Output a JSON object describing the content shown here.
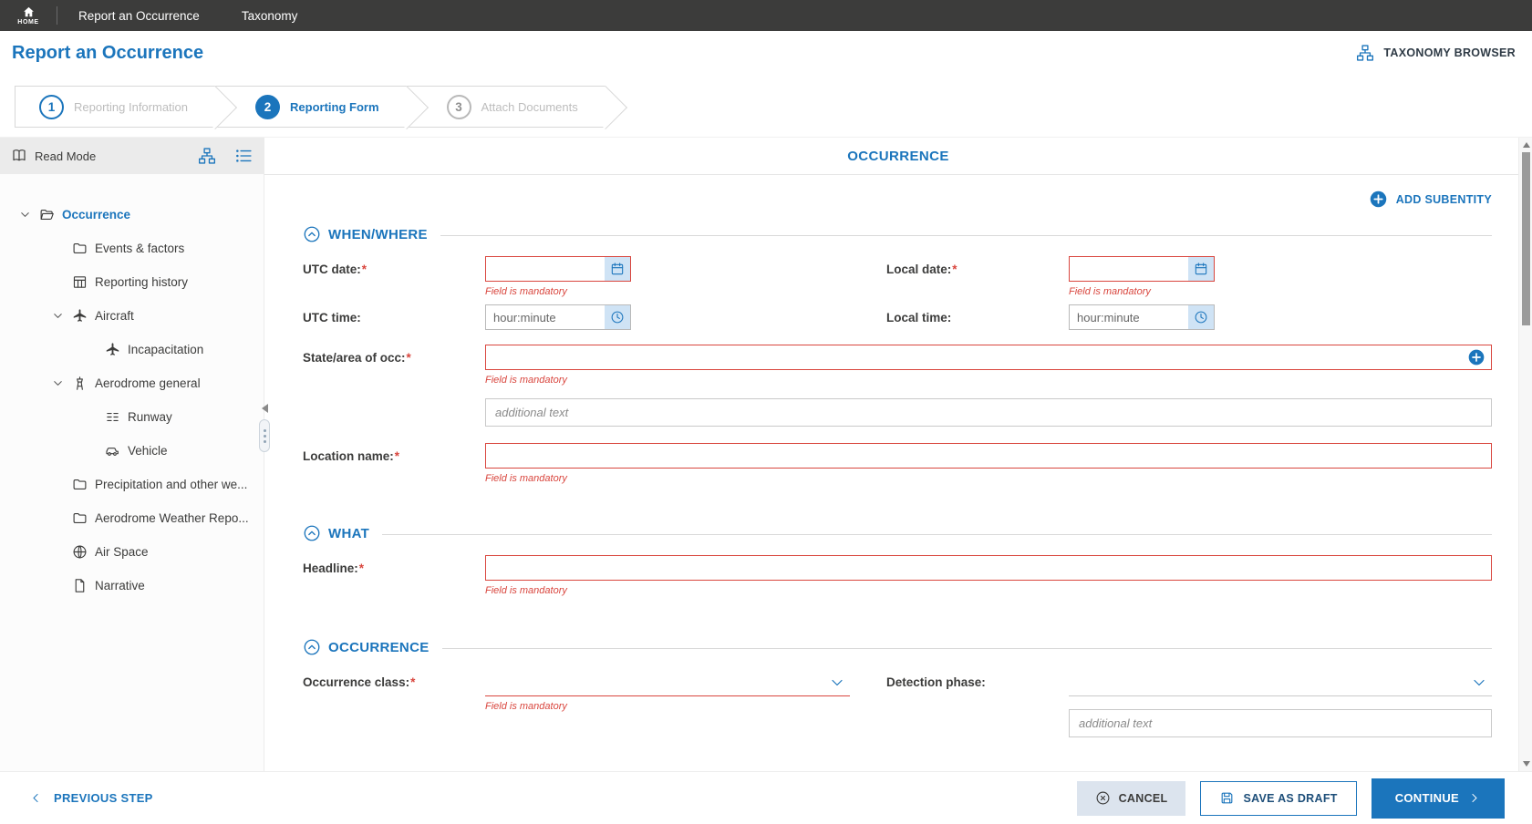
{
  "colors": {
    "accent_blue": "#1b75bc",
    "error_red": "#d9463e",
    "topnav_bg": "#3c3c3b"
  },
  "misc": {
    "required_mark": "*"
  },
  "topnav": {
    "home_label": "HOME",
    "items": [
      {
        "label": "Report an Occurrence"
      },
      {
        "label": "Taxonomy"
      }
    ]
  },
  "header": {
    "title": "Report an Occurrence",
    "taxonomy_browser_label": "TAXONOMY BROWSER"
  },
  "stepper": {
    "steps": [
      {
        "number": "1",
        "label": "Reporting Information",
        "state": "done"
      },
      {
        "number": "2",
        "label": "Reporting Form",
        "state": "active"
      },
      {
        "number": "3",
        "label": "Attach Documents",
        "state": "upcoming"
      }
    ]
  },
  "sidebar": {
    "read_mode_label": "Read Mode",
    "tree": [
      {
        "label": "Occurrence",
        "icon": "folder-open-icon",
        "level": 0,
        "expanded": true,
        "selected": true
      },
      {
        "label": "Events & factors",
        "icon": "folder-icon",
        "level": 1
      },
      {
        "label": "Reporting history",
        "icon": "table-icon",
        "level": 1
      },
      {
        "label": "Aircraft",
        "icon": "aircraft-icon",
        "level": 1,
        "expanded": true
      },
      {
        "label": "Incapacitation",
        "icon": "aircraft-icon",
        "level": 2
      },
      {
        "label": "Aerodrome general",
        "icon": "tower-icon",
        "level": 1,
        "expanded": true
      },
      {
        "label": "Runway",
        "icon": "runway-icon",
        "level": 2
      },
      {
        "label": "Vehicle",
        "icon": "vehicle-icon",
        "level": 2
      },
      {
        "label": "Precipitation and other we...",
        "icon": "folder-icon",
        "level": 1
      },
      {
        "label": "Aerodrome Weather Repo...",
        "icon": "folder-icon",
        "level": 1
      },
      {
        "label": "Air Space",
        "icon": "globe-icon",
        "level": 1
      },
      {
        "label": "Narrative",
        "icon": "document-icon",
        "level": 1
      }
    ]
  },
  "content": {
    "entity_title": "OCCURRENCE",
    "add_subentity_label": "ADD SUBENTITY",
    "sections": {
      "when_where": {
        "title": "WHEN/WHERE"
      },
      "what": {
        "title": "WHAT"
      },
      "occurrence": {
        "title": "OCCURRENCE"
      }
    },
    "fields": {
      "utc_date": {
        "label": "UTC date:",
        "error": "Field is mandatory"
      },
      "local_date": {
        "label": "Local date:",
        "error": "Field is mandatory"
      },
      "utc_time": {
        "label": "UTC time:",
        "placeholder": "hour:minute"
      },
      "local_time": {
        "label": "Local time:",
        "placeholder": "hour:minute"
      },
      "state_area": {
        "label": "State/area of occ:",
        "error": "Field is mandatory",
        "additional_placeholder": "additional text"
      },
      "location_name": {
        "label": "Location name:",
        "error": "Field is mandatory"
      },
      "headline": {
        "label": "Headline:",
        "error": "Field is mandatory"
      },
      "occurrence_class": {
        "label": "Occurrence class:",
        "error": "Field is mandatory"
      },
      "detection_phase": {
        "label": "Detection phase:",
        "additional_placeholder": "additional text"
      }
    }
  },
  "footer": {
    "previous_label": "PREVIOUS STEP",
    "cancel_label": "CANCEL",
    "save_draft_label": "SAVE AS DRAFT",
    "continue_label": "CONTINUE"
  }
}
